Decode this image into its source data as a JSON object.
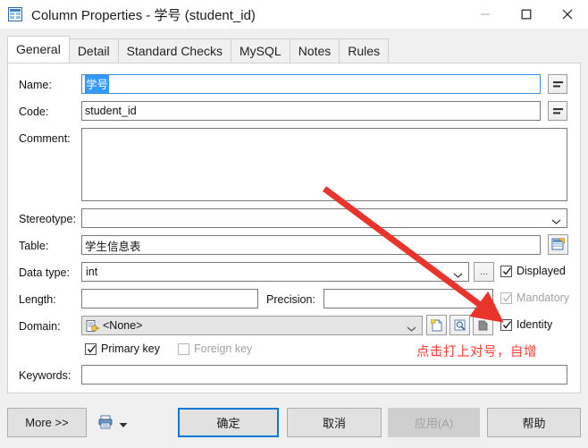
{
  "window": {
    "title": "Column Properties - 学号 (student_id)",
    "icon": "table-grid-icon",
    "minimize_label": "—",
    "maximize_label": "□",
    "close_label": "✕"
  },
  "tabs": [
    {
      "label": "General",
      "active": true
    },
    {
      "label": "Detail",
      "active": false
    },
    {
      "label": "Standard Checks",
      "active": false
    },
    {
      "label": "MySQL",
      "active": false
    },
    {
      "label": "Notes",
      "active": false
    },
    {
      "label": "Rules",
      "active": false
    }
  ],
  "form": {
    "name": {
      "label": "Name:",
      "value": "学号",
      "selected": true,
      "button_glyph": "="
    },
    "code": {
      "label": "Code:",
      "value": "student_id",
      "button_glyph": "="
    },
    "comment": {
      "label": "Comment:",
      "value": ""
    },
    "stereotype": {
      "label": "Stereotype:",
      "value": ""
    },
    "table": {
      "label": "Table:",
      "value": "学生信息表",
      "button_icon": "table-properties-icon"
    },
    "data_type": {
      "label": "Data type:",
      "value": "int",
      "ellipsis_label": "..."
    },
    "displayed": {
      "label": "Displayed",
      "checked": true,
      "enabled": true
    },
    "length": {
      "label": "Length:",
      "value": ""
    },
    "precision": {
      "label": "Precision:",
      "value": ""
    },
    "mandatory": {
      "label": "Mandatory",
      "checked": true,
      "enabled": false
    },
    "domain": {
      "label": "Domain:",
      "value": "<None>",
      "icon": "domain-key-icon",
      "tool_icons": [
        "new-domain-icon",
        "browse-domain-icon",
        "domain-properties-icon"
      ]
    },
    "identity": {
      "label": "Identity",
      "checked": true,
      "enabled": true
    },
    "primary_key": {
      "label": "Primary key",
      "checked": true,
      "enabled": true
    },
    "foreign_key": {
      "label": "Foreign key",
      "checked": false,
      "enabled": false
    },
    "keywords": {
      "label": "Keywords:",
      "value": ""
    }
  },
  "footer": {
    "more_label": "More >>",
    "print_icon": "printer-icon",
    "print_dropdown_icon": "chevron-down-icon",
    "ok_label": "确定",
    "cancel_label": "取消",
    "apply_label": "应用(A)",
    "help_label": "帮助"
  },
  "annotations": {
    "note_text": "点击打上对号，自增",
    "arrow_color": "#e8342b",
    "note_color": "#ff3b30"
  }
}
